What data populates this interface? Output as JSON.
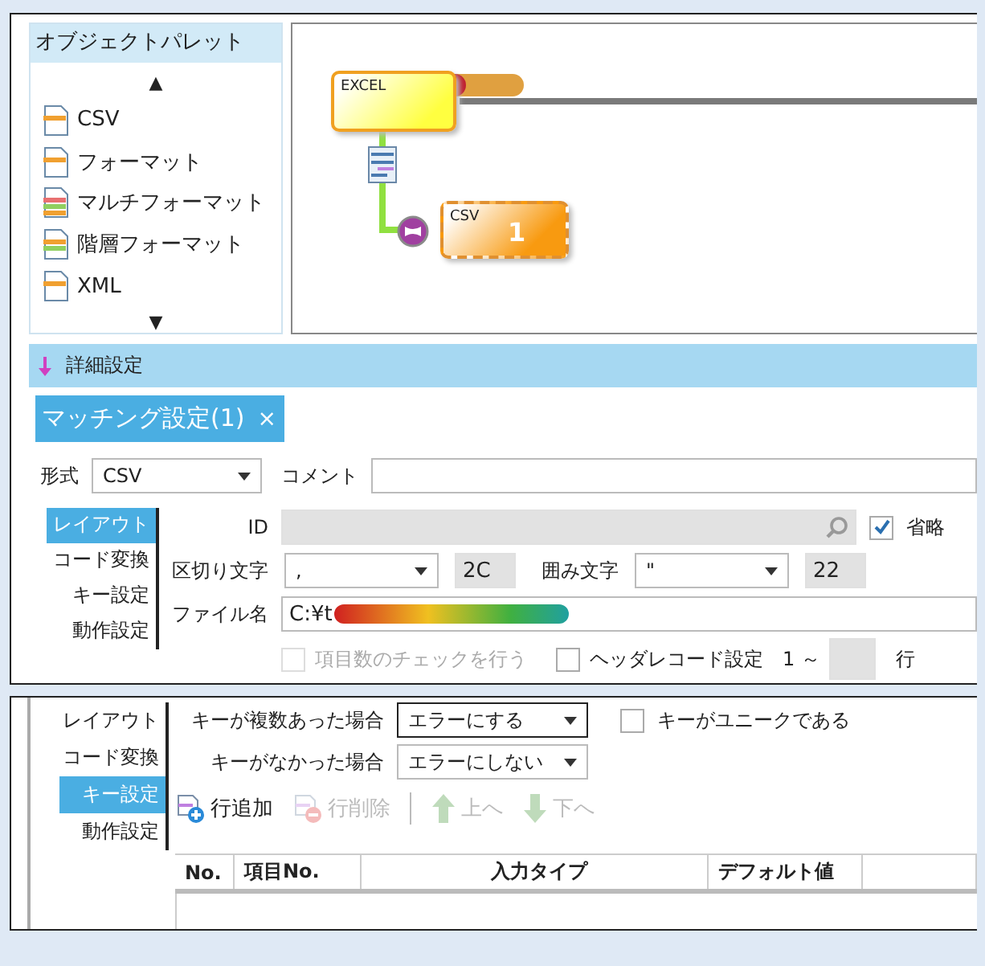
{
  "palette": {
    "title": "オブジェクトパレット",
    "up": "▲",
    "down": "▼",
    "items": [
      {
        "label": "CSV",
        "kind": "csv"
      },
      {
        "label": "フォーマット",
        "kind": "format"
      },
      {
        "label": "マルチフォーマット",
        "kind": "multi"
      },
      {
        "label": "階層フォーマット",
        "kind": "tree"
      },
      {
        "label": "XML",
        "kind": "xml"
      }
    ]
  },
  "canvas": {
    "nodes": [
      {
        "label": "EXCEL",
        "kind": "source"
      },
      {
        "label": "CSV",
        "kind": "target",
        "badge": "1"
      }
    ]
  },
  "detail": {
    "title": "詳細設定",
    "tabs": [
      {
        "label": "マッチング設定(1)",
        "selected": true,
        "close": "×"
      }
    ],
    "format": {
      "label": "形式",
      "value": "CSV"
    },
    "comment": {
      "label": "コメント"
    },
    "side_tabs": [
      {
        "label": "レイアウト",
        "selected": true
      },
      {
        "label": "コード変換",
        "selected": false
      },
      {
        "label": "キー設定",
        "selected": false
      },
      {
        "label": "動作設定",
        "selected": false
      }
    ],
    "id": {
      "label": "ID"
    },
    "omit": {
      "label": "省略",
      "checked": true
    },
    "delimiter": {
      "label": "区切り文字",
      "value": ",",
      "code": "2C"
    },
    "quote": {
      "label": "囲み文字",
      "value": "\"",
      "code": "22"
    },
    "file": {
      "label": "ファイル名",
      "value": "C:¥t"
    },
    "item_check": {
      "label": "項目数のチェックを行う",
      "checked": false,
      "disabled": true
    },
    "header": {
      "label": "ヘッダレコード設定",
      "checked": false
    },
    "range": "1 ～",
    "row_unit": "行"
  },
  "key_panel": {
    "side_tabs": [
      {
        "label": "レイアウト",
        "selected": false
      },
      {
        "label": "コード変換",
        "selected": false
      },
      {
        "label": "キー設定",
        "selected": true
      },
      {
        "label": "動作設定",
        "selected": false
      }
    ],
    "multiple": {
      "label": "キーが複数あった場合",
      "value": "エラーにする"
    },
    "unique": {
      "label": "キーがユニークである",
      "checked": false
    },
    "missing": {
      "label": "キーがなかった場合",
      "value": "エラーにしない"
    },
    "toolbar": [
      {
        "label": "行追加",
        "kind": "add",
        "disabled": false
      },
      {
        "label": "行削除",
        "kind": "remove",
        "disabled": true
      },
      {
        "label": "上へ",
        "kind": "up",
        "disabled": true
      },
      {
        "label": "下へ",
        "kind": "down",
        "disabled": true
      }
    ],
    "columns": [
      "No.",
      "項目No.",
      "入力タイプ",
      "デフォルト値"
    ]
  }
}
